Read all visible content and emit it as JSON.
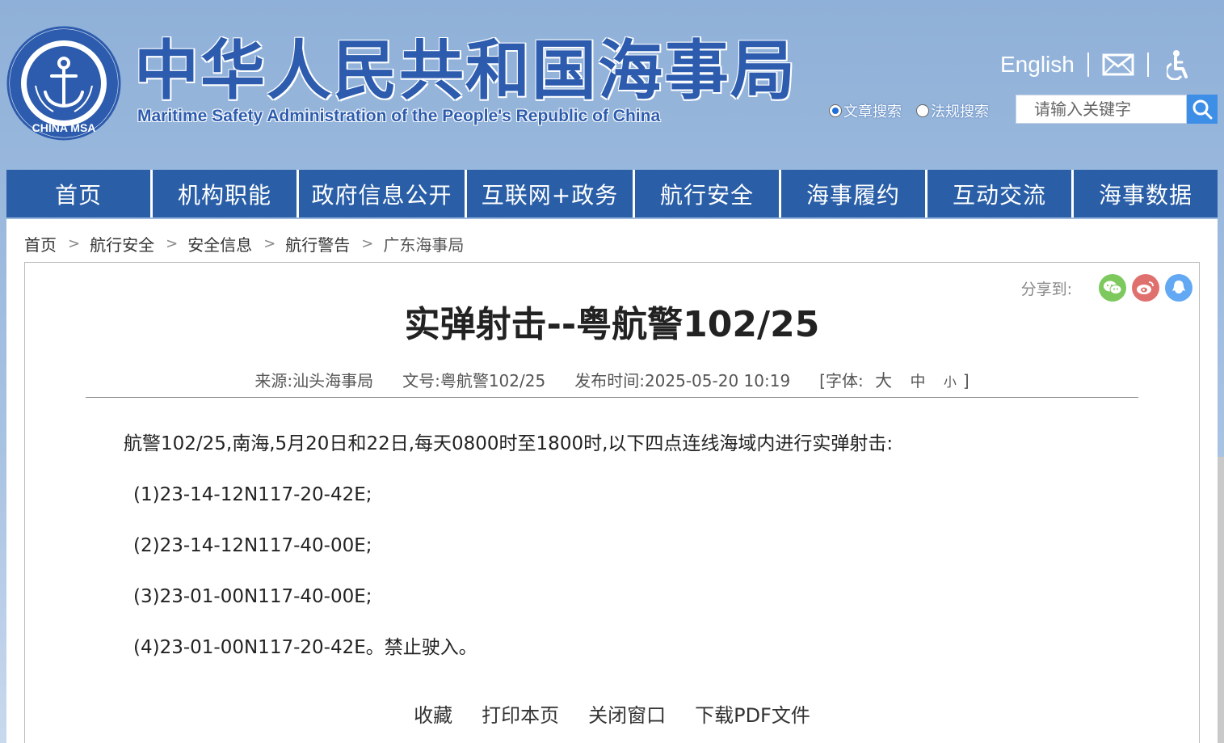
{
  "header": {
    "title": "中华人民共和国海事局",
    "subtitle": "Maritime Safety Administration of the People's Republic of China",
    "logo_text": "CHINA MSA",
    "english_link": "English",
    "search_options": [
      "文章搜索",
      "法规搜索"
    ],
    "search_selected": "文章搜索",
    "search_placeholder": "请输入关键字"
  },
  "nav": [
    {
      "label": "首页"
    },
    {
      "label": "机构职能"
    },
    {
      "label": "政府信息公开"
    },
    {
      "label": "互联网+政务"
    },
    {
      "label": "航行安全"
    },
    {
      "label": "海事履约"
    },
    {
      "label": "互动交流"
    },
    {
      "label": "海事数据"
    }
  ],
  "breadcrumb": [
    "首页",
    "航行安全",
    "安全信息",
    "航行警告",
    "广东海事局"
  ],
  "share": {
    "label": "分享到:"
  },
  "article": {
    "title": "实弹射击--粤航警102/25",
    "source": "来源:汕头海事局",
    "doc_no": "文号:粤航警102/25",
    "published": "发布时间:2025-05-20 10:19",
    "font_label": "[字体:",
    "font_large": "大",
    "font_medium": "中",
    "font_small": "小",
    "font_close": "]",
    "paragraphs": [
      "航警102/25,南海,5月20日和22日,每天0800时至1800时,以下四点连线海域内进行实弹射击:",
      "(1)23-14-12N117-20-42E;",
      "(2)23-14-12N117-40-00E;",
      "(3)23-01-00N117-40-00E;",
      "(4)23-01-00N117-20-42E。禁止驶入。"
    ]
  },
  "actions": [
    "收藏",
    "打印本页",
    "关闭窗口",
    "下载PDF文件"
  ],
  "colors": {
    "nav_bg": "#2a5fa8",
    "title_blue": "#2d5cae",
    "wechat": "#7dc95e",
    "weibo": "#e0706d",
    "qq": "#63a8f2"
  }
}
